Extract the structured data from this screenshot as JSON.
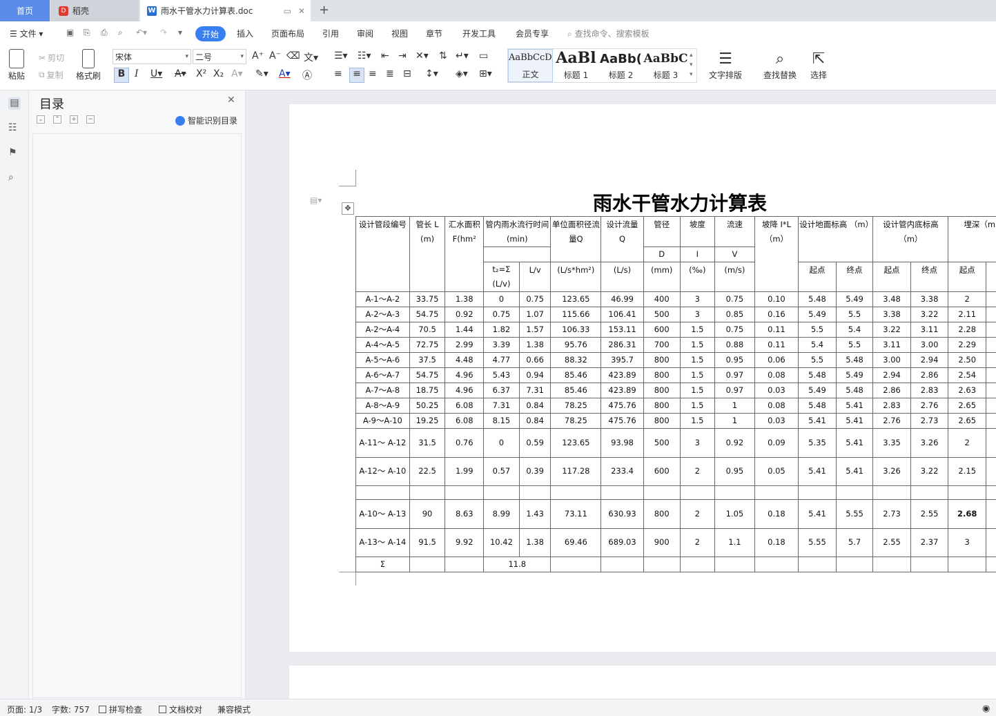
{
  "tabs": {
    "home": "首页",
    "daoke": "稻壳",
    "doc": "雨水干管水力计算表.doc",
    "new_tab": "+"
  },
  "menu": {
    "file": "文件",
    "items": [
      "开始",
      "插入",
      "页面布局",
      "引用",
      "审阅",
      "视图",
      "章节",
      "开发工具",
      "会员专享"
    ],
    "search": "查找命令、搜索模板"
  },
  "ribbon": {
    "paste": "粘贴",
    "cut": "剪切",
    "copy": "复制",
    "format_painter": "格式刷",
    "font": "宋体",
    "size": "二号",
    "styles": [
      {
        "preview": "AaBbCcDd",
        "name": "正文"
      },
      {
        "preview": "AaBl",
        "name": "标题 1"
      },
      {
        "preview": "AaBb(",
        "name": "标题 2"
      },
      {
        "preview": "AaBbC",
        "name": "标题 3"
      }
    ],
    "text_layout": "文字排版",
    "find_replace": "查找替换",
    "select": "选择"
  },
  "toc": {
    "title": "目录",
    "smart": "智能识别目录"
  },
  "document": {
    "title": "雨水干管水力计算表",
    "header": {
      "seg": "设计管段编号",
      "len": "管长 L (m)",
      "area": "汇水面积 F(hm²",
      "time": "管内雨水流行时间 (min)",
      "t2": "t₂=Σ (L/v)",
      "lv": "L/v",
      "unit_q": "单位面积径流量Q",
      "unit_q_unit": "(L/s*hm²)",
      "design_q": "设计流量 Q",
      "design_q_unit": "(L/s)",
      "dia": "管径",
      "dia_sym": "D",
      "dia_unit": "(mm)",
      "slope": "坡度",
      "slope_sym": "I",
      "slope_unit": "(‰)",
      "vel": "流速",
      "vel_sym": "V",
      "vel_unit": "(m/s)",
      "drop": "坡降 I*L （m）",
      "ground": "设计地面标高 （m）",
      "invert": "设计管内底标高 （m）",
      "depth": "埋深（m",
      "start": "起点",
      "end": "终点"
    },
    "rows": [
      [
        "A-1～A-2",
        "33.75",
        "1.38",
        "0",
        "0.75",
        "123.65",
        "46.99",
        "400",
        "3",
        "0.75",
        "0.10",
        "5.48",
        "5.49",
        "3.48",
        "3.38",
        "2"
      ],
      [
        "A-2～A-3",
        "54.75",
        "0.92",
        "0.75",
        "1.07",
        "115.66",
        "106.41",
        "500",
        "3",
        "0.85",
        "0.16",
        "5.49",
        "5.5",
        "3.38",
        "3.22",
        "2.11"
      ],
      [
        "A-2～A-4",
        "70.5",
        "1.44",
        "1.82",
        "1.57",
        "106.33",
        "153.11",
        "600",
        "1.5",
        "0.75",
        "0.11",
        "5.5",
        "5.4",
        "3.22",
        "3.11",
        "2.28"
      ],
      [
        "A-4～A-5",
        "72.75",
        "2.99",
        "3.39",
        "1.38",
        "95.76",
        "286.31",
        "700",
        "1.5",
        "0.88",
        "0.11",
        "5.4",
        "5.5",
        "3.11",
        "3.00",
        "2.29"
      ],
      [
        "A-5～A-6",
        "37.5",
        "4.48",
        "4.77",
        "0.66",
        "88.32",
        "395.7",
        "800",
        "1.5",
        "0.95",
        "0.06",
        "5.5",
        "5.48",
        "3.00",
        "2.94",
        "2.50"
      ],
      [
        "A-6～A-7",
        "54.75",
        "4.96",
        "5.43",
        "0.94",
        "85.46",
        "423.89",
        "800",
        "1.5",
        "0.97",
        "0.08",
        "5.48",
        "5.49",
        "2.94",
        "2.86",
        "2.54"
      ],
      [
        "A-7～A-8",
        "18.75",
        "4.96",
        "6.37",
        "7.31",
        "85.46",
        "423.89",
        "800",
        "1.5",
        "0.97",
        "0.03",
        "5.49",
        "5.48",
        "2.86",
        "2.83",
        "2.63"
      ],
      [
        "A-8～A-9",
        "50.25",
        "6.08",
        "7.31",
        "0.84",
        "78.25",
        "475.76",
        "800",
        "1.5",
        "1",
        "0.08",
        "5.48",
        "5.41",
        "2.83",
        "2.76",
        "2.65"
      ],
      [
        "A-9～A-10",
        "19.25",
        "6.08",
        "8.15",
        "0.84",
        "78.25",
        "475.76",
        "800",
        "1.5",
        "1",
        "0.03",
        "5.41",
        "5.41",
        "2.76",
        "2.73",
        "2.65"
      ]
    ],
    "rows_tall_a": [
      [
        "A-11～ A-12",
        "31.5",
        "0.76",
        "0",
        "0.59",
        "123.65",
        "93.98",
        "500",
        "3",
        "0.92",
        "0.09",
        "5.35",
        "5.41",
        "3.35",
        "3.26",
        "2"
      ],
      [
        "A-12～ A-10",
        "22.5",
        "1.99",
        "0.57",
        "0.39",
        "117.28",
        "233.4",
        "600",
        "2",
        "0.95",
        "0.05",
        "5.41",
        "5.41",
        "3.26",
        "3.22",
        "2.15"
      ]
    ],
    "rows_tall_b": [
      [
        "A-10～ A-13",
        "90",
        "8.63",
        "8.99",
        "1.43",
        "73.11",
        "630.93",
        "800",
        "2",
        "1.05",
        "0.18",
        "5.41",
        "5.55",
        "2.73",
        "2.55",
        "2.68"
      ],
      [
        "A-13～ A-14",
        "91.5",
        "9.92",
        "10.42",
        "1.38",
        "69.46",
        "689.03",
        "900",
        "2",
        "1.1",
        "0.18",
        "5.55",
        "5.7",
        "2.55",
        "2.37",
        "3"
      ]
    ],
    "sum_label": "Σ",
    "sum_value": "11.8"
  },
  "status": {
    "page": "页面: 1/3",
    "words": "字数: 757",
    "spell": "拼写检查",
    "proof": "文档校对",
    "compat": "兼容模式"
  }
}
